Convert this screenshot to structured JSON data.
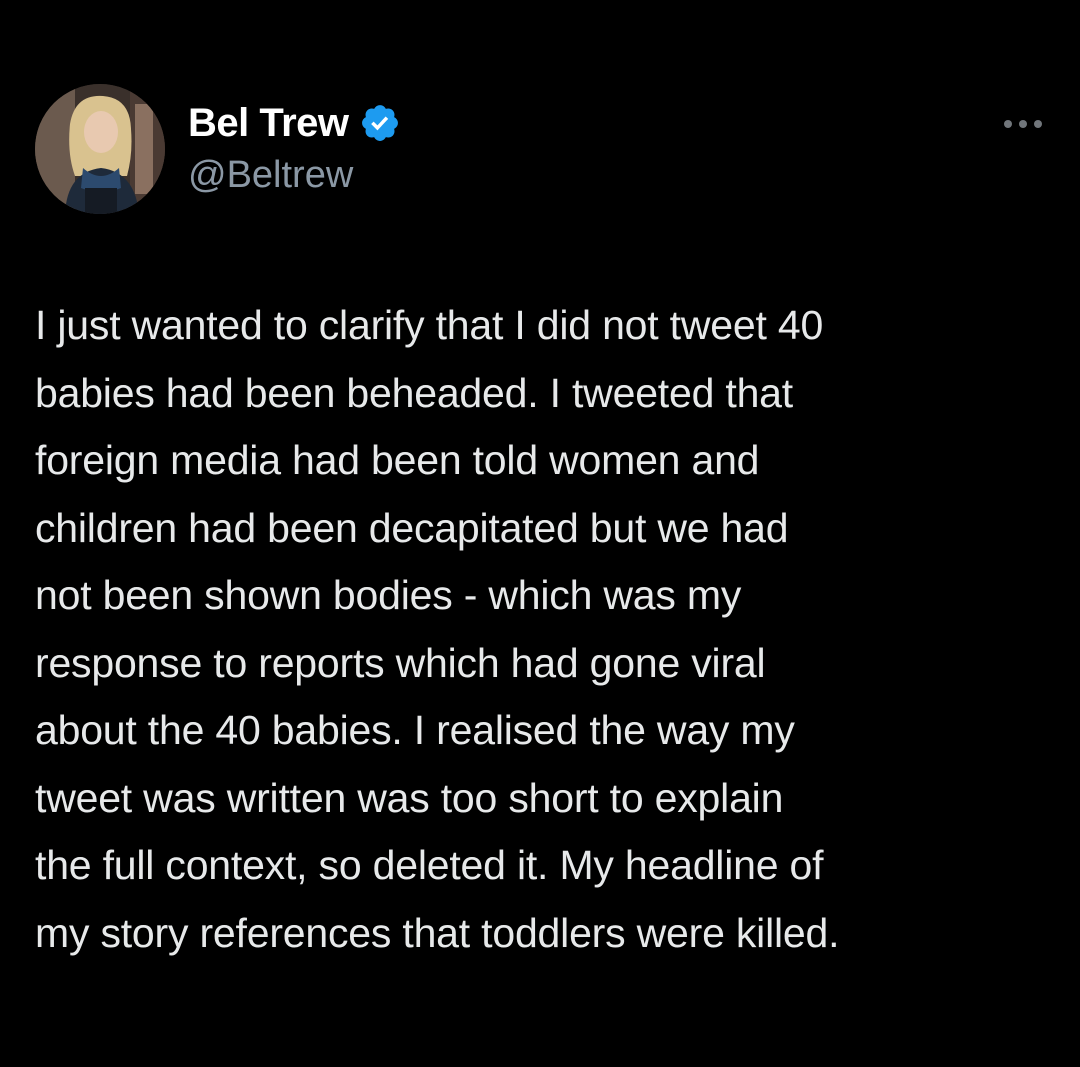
{
  "author": {
    "name": "Bel Trew",
    "handle": "@Beltrew",
    "verified": true,
    "avatar_icon": "profile-photo",
    "verified_icon": "verified-check-icon"
  },
  "actions": {
    "more_icon": "more-options-icon"
  },
  "tweet": {
    "lines": [
      "I just wanted to clarify that I did not tweet 40",
      "babies had been beheaded. I tweeted that",
      "foreign media had been told women and",
      "children had been decapitated but we had",
      "not been shown bodies - which was my",
      "response to reports which had gone viral",
      "about the 40 babies. I realised the way my",
      "tweet was written was too short to explain",
      "the full context, so deleted it. My headline of",
      "my story references that toddlers were killed."
    ]
  },
  "colors": {
    "background": "#000000",
    "name": "#ffffff",
    "text": "#e7e9ea",
    "handle": "#8b98a5",
    "verified": "#1d9bf0"
  }
}
